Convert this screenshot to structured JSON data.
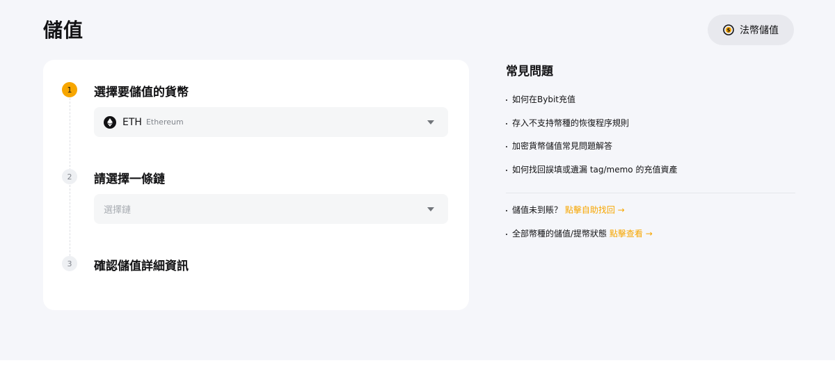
{
  "header": {
    "title": "儲值",
    "fiat_button_label": "法幣儲值"
  },
  "steps": [
    {
      "number": "1",
      "title": "選擇要儲值的貨幣"
    },
    {
      "number": "2",
      "title": "請選擇一條鏈"
    },
    {
      "number": "3",
      "title": "確認儲值詳細資訊"
    }
  ],
  "coin_select": {
    "symbol": "ETH",
    "name": "Ethereum",
    "icon": "ethereum-icon"
  },
  "chain_select": {
    "placeholder": "選擇鏈"
  },
  "faq": {
    "title": "常見問題",
    "items": [
      "如何在Bybit充值",
      "存入不支持幣種的恢復程序規則",
      "加密貨幣儲值常見問題解答",
      "如何找回誤填或遺漏 tag/memo 的充值資產"
    ],
    "links": [
      {
        "text": "儲值未到賬？",
        "link": "點擊自助找回 →"
      },
      {
        "text": "全部幣種的儲值/提幣狀態",
        "link": "點擊查看 →"
      }
    ]
  },
  "colors": {
    "accent": "#f7a600",
    "background": "#f5f6fa",
    "card": "#ffffff"
  }
}
